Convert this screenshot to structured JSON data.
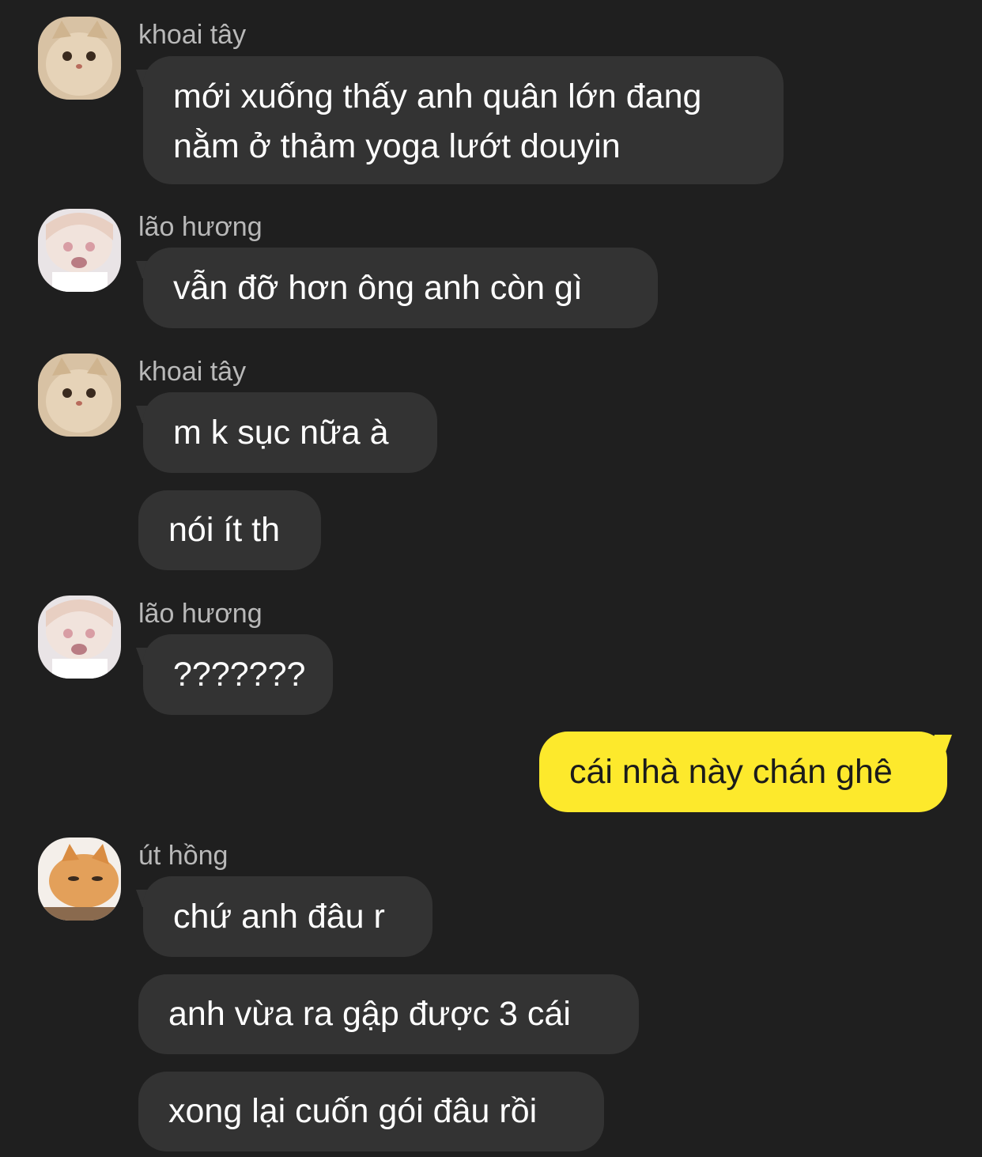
{
  "colors": {
    "background": "#1f1f1f",
    "incoming_bubble": "#333333",
    "outgoing_bubble": "#fde92c",
    "sender_name": "#b9b9b9"
  },
  "messages": [
    {
      "sender": "khoai tây",
      "avatar": "cat-avatar-icon",
      "text": "mới xuống thấy anh quân lớn đang nằm ở thảm yoga lướt douyin"
    },
    {
      "sender": "lão hương",
      "avatar": "anime-girl-avatar-icon",
      "text": "vẫn đỡ hơn ông anh còn gì"
    },
    {
      "sender": "khoai tây",
      "avatar": "cat-avatar-icon",
      "text": "m k sục nữa à"
    },
    {
      "text": "nói ít th"
    },
    {
      "sender": "lão hương",
      "avatar": "anime-girl-avatar-icon",
      "text": "???????"
    },
    {
      "mine": true,
      "text": "cái nhà này chán ghê"
    },
    {
      "sender": "út hồng",
      "avatar": "orange-cat-avatar-icon",
      "text": "chứ anh đâu r"
    },
    {
      "text": "anh vừa ra gập được 3 cái"
    },
    {
      "text": "xong lại cuốn gói đâu rồi"
    }
  ]
}
